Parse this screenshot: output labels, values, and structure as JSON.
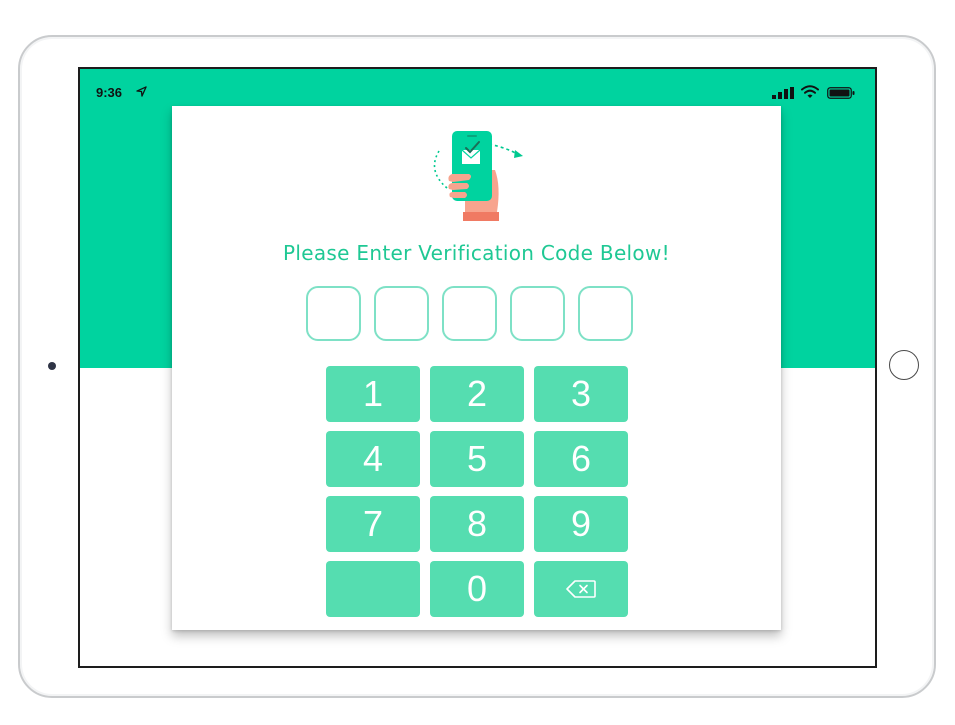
{
  "status_bar": {
    "time": "9:36",
    "icons": [
      "location-icon",
      "signal-icon",
      "wifi-icon",
      "battery-icon"
    ]
  },
  "verification": {
    "title": "Please Enter Verification Code Below!",
    "code_digits": [
      "",
      "",
      "",
      "",
      ""
    ]
  },
  "keypad": {
    "keys": [
      "1",
      "2",
      "3",
      "4",
      "5",
      "6",
      "7",
      "8",
      "9",
      "",
      "0",
      "⌫"
    ],
    "blank_key": "",
    "backspace_icon": "backspace-icon"
  },
  "colors": {
    "accent": "#00d39f",
    "key_fill": "#55ddb0",
    "title_text": "#1fc894",
    "box_border": "#7ee1c6",
    "hand_skin": "#f7a48e",
    "cuff": "#f07a63"
  }
}
